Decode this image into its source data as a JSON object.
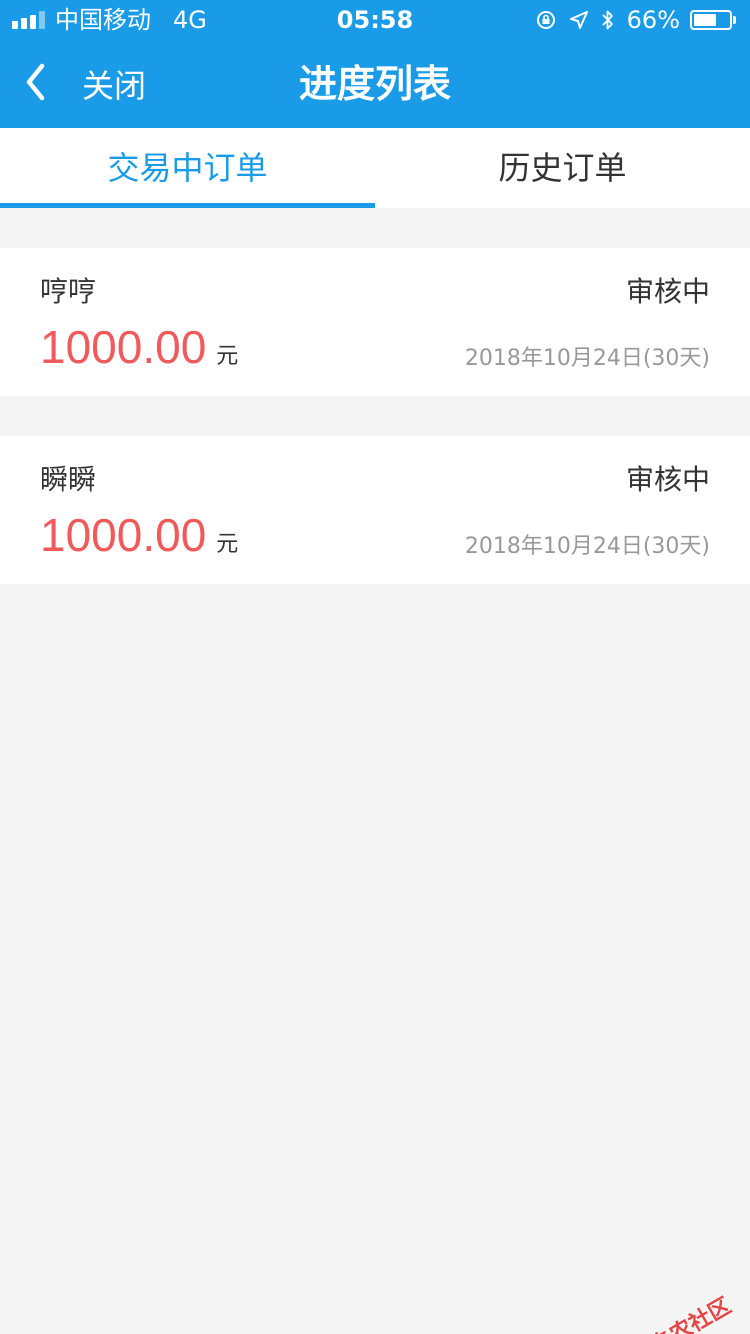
{
  "status_bar": {
    "carrier": "中国移动",
    "network": "4G",
    "time": "05:58",
    "battery": "66%",
    "battery_level": 0.66
  },
  "nav": {
    "back_label": "关闭",
    "title": "进度列表"
  },
  "tabs": [
    {
      "label": "交易中订单",
      "active": true
    },
    {
      "label": "历史订单",
      "active": false
    }
  ],
  "orders": [
    {
      "name": "哼哼",
      "status": "审核中",
      "amount": "1000.00",
      "unit": "元",
      "date": "2018年10月24日(30天)"
    },
    {
      "name": "瞬瞬",
      "status": "审核中",
      "amount": "1000.00",
      "unit": "元",
      "date": "2018年10月24日(30天)"
    }
  ],
  "watermark": {
    "text": "卡农社区"
  },
  "colors": {
    "primary": "#1a9be8",
    "amount": "#f05a5a",
    "background": "#f4f4f4"
  }
}
